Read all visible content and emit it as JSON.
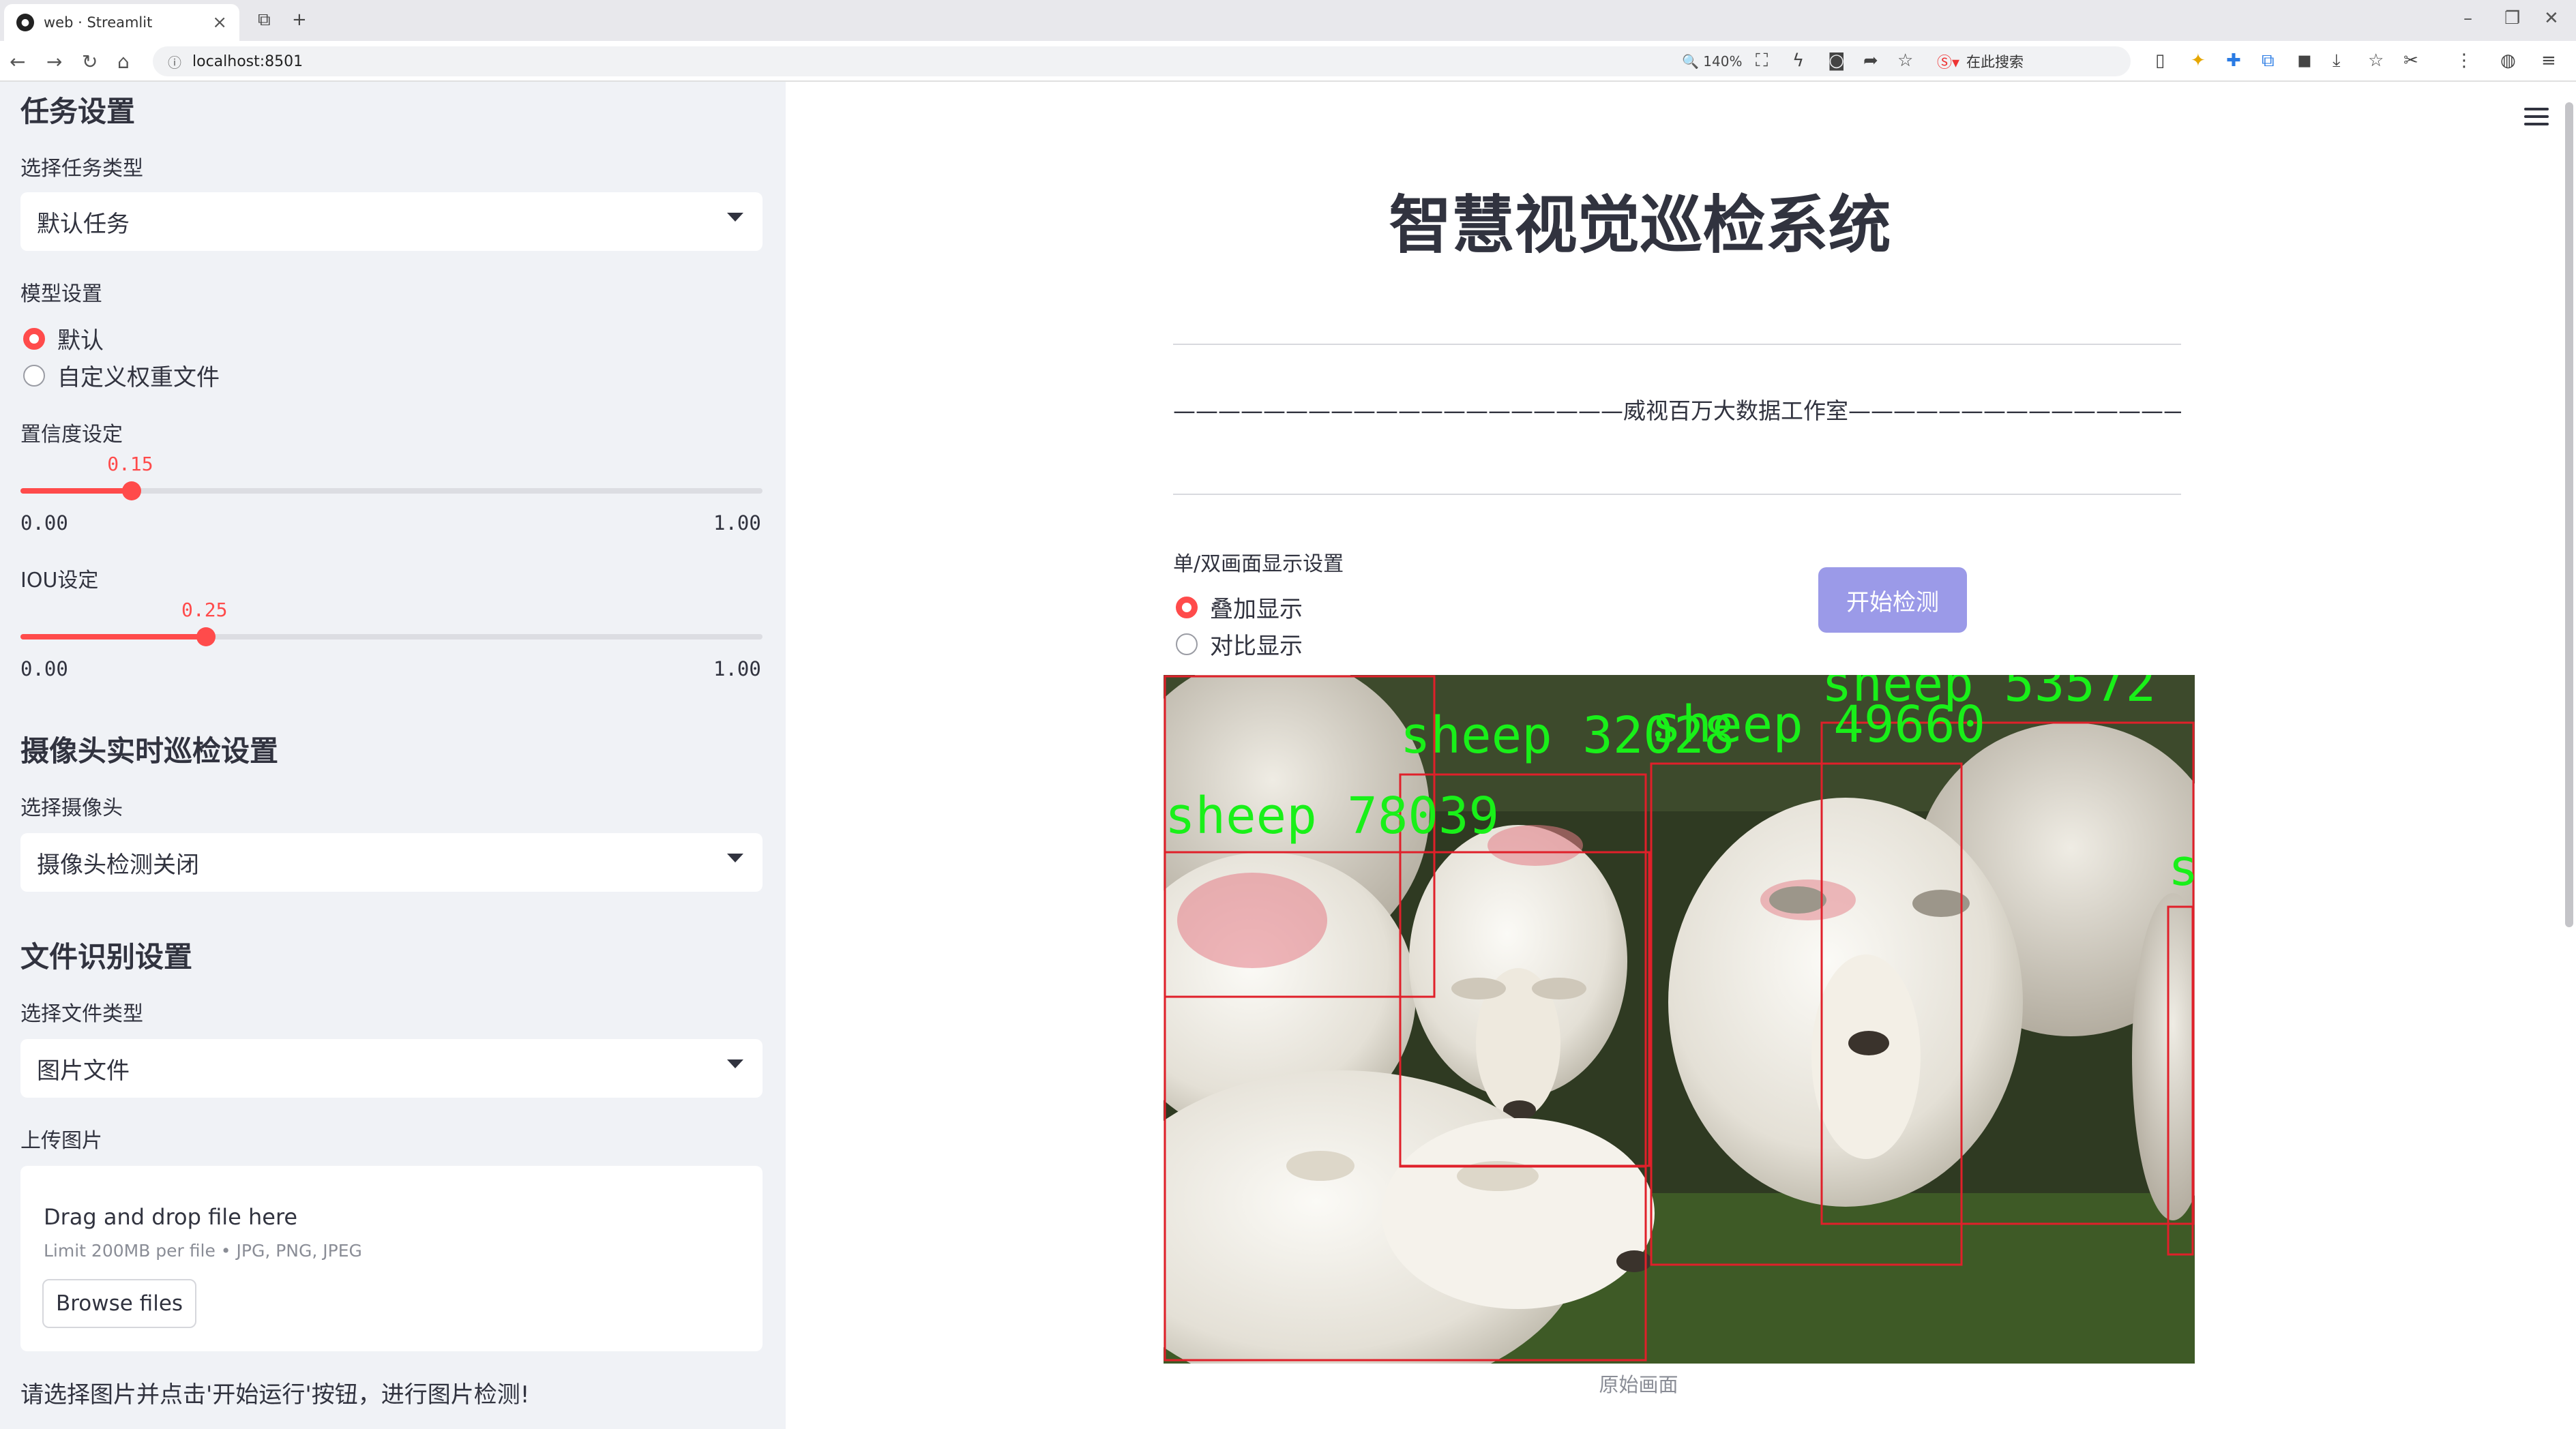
{
  "browser": {
    "tab_title": "web · Streamlit",
    "url": "localhost:8501",
    "zoom": "140%",
    "search_placeholder": "在此搜索"
  },
  "sidebar": {
    "task_header": "任务设置",
    "task_type_label": "选择任务类型",
    "task_type_value": "默认任务",
    "model_label": "模型设置",
    "model_options": [
      "默认",
      "自定义权重文件"
    ],
    "model_selected": 0,
    "confidence": {
      "label": "置信度设定",
      "value": "0.15",
      "fraction": 0.15,
      "min": "0.00",
      "max": "1.00"
    },
    "iou": {
      "label": "IOU设定",
      "value": "0.25",
      "fraction": 0.25,
      "min": "0.00",
      "max": "1.00"
    },
    "camera_header": "摄像头实时巡检设置",
    "camera_label": "选择摄像头",
    "camera_value": "摄像头检测关闭",
    "file_header": "文件识别设置",
    "file_type_label": "选择文件类型",
    "file_type_value": "图片文件",
    "upload_label": "上传图片",
    "upload_title": "Drag and drop file here",
    "upload_limit": "Limit 200MB per file • JPG, PNG, JPEG",
    "browse_label": "Browse files",
    "note": "请选择图片并点击'开始运行'按钮，进行图片检测!"
  },
  "main": {
    "title": "智慧视觉巡检系统",
    "studio_line": "————————————————————威视百万大数据工作室—————————————————————",
    "display_label": "单/双画面显示设置",
    "display_options": [
      "叠加显示",
      "对比显示"
    ],
    "display_selected": 0,
    "start_button": "开始检测",
    "caption": "原始画面",
    "detections": [
      {
        "label": "sheep 78039"
      },
      {
        "label": "sheep 32028"
      },
      {
        "label": "sheep 49660"
      },
      {
        "label": "sheep 53572"
      },
      {
        "label": "s"
      }
    ]
  },
  "colors": {
    "accent": "#ff4b4b",
    "button": "#9b9ae8",
    "sidebar_bg": "#f0f2f6",
    "box_red": "#e0202a",
    "label_green": "#19f019"
  }
}
